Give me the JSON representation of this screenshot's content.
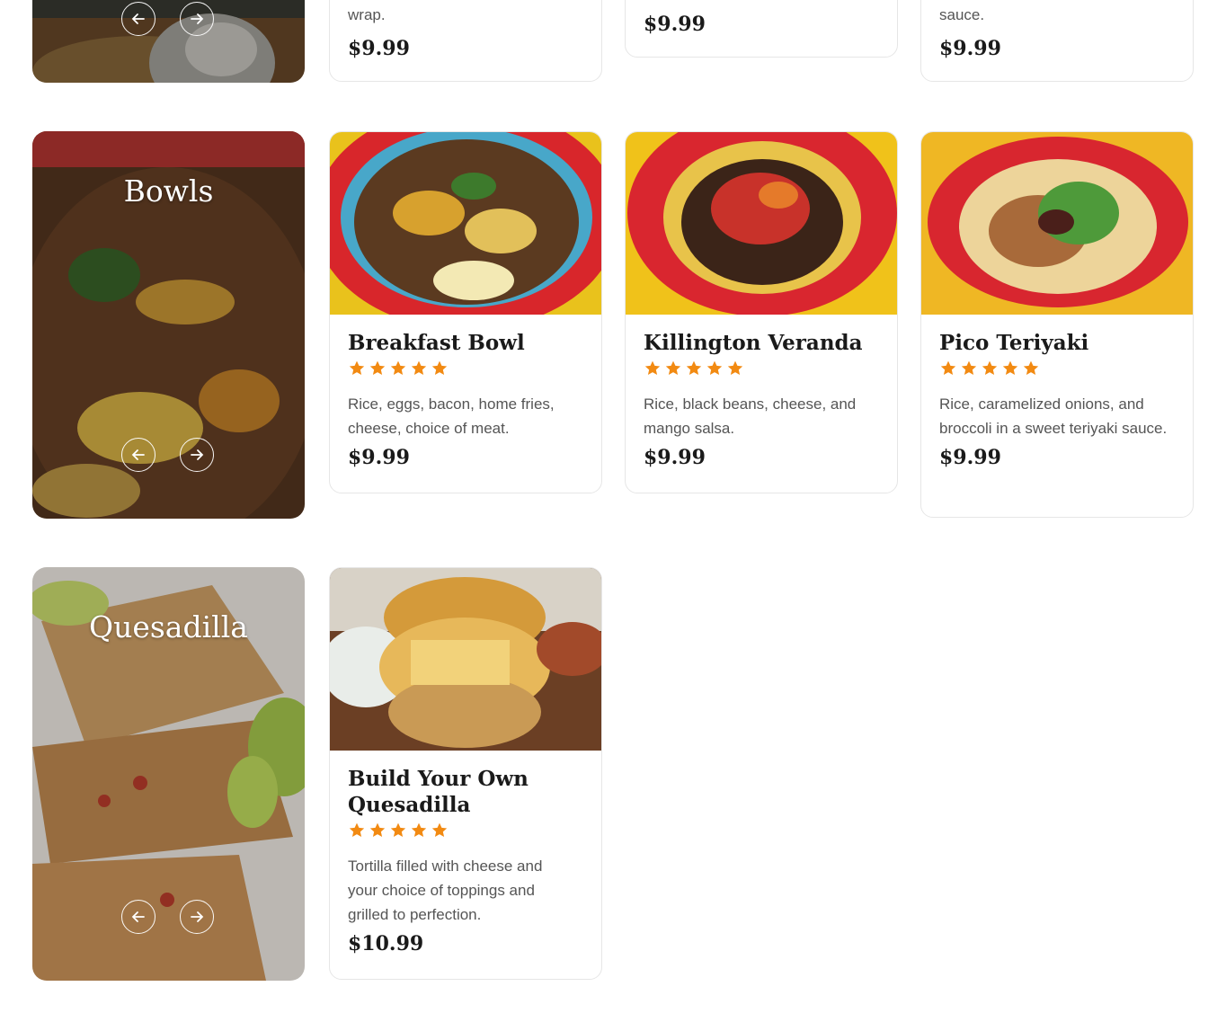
{
  "colors": {
    "star": "#f28a12",
    "card_border": "#e6e6e6",
    "price_text": "#1a1a1a",
    "desc_text": "#555555"
  },
  "top_row": {
    "card1": {
      "desc_tail": "wrap.",
      "price": "$9.99"
    },
    "card2": {
      "price": "$9.99"
    },
    "card3": {
      "desc_tail": "sauce.",
      "price": "$9.99"
    }
  },
  "categories": [
    {
      "title": "Bowls",
      "prev_icon": "arrow-left-icon",
      "next_icon": "arrow-right-icon"
    },
    {
      "title": "Quesadilla",
      "prev_icon": "arrow-left-icon",
      "next_icon": "arrow-right-icon"
    }
  ],
  "bowls": [
    {
      "name": "Breakfast Bowl",
      "rating": 5,
      "desc": "Rice, eggs, bacon, home fries, cheese, choice of meat.",
      "price": "$9.99"
    },
    {
      "name": "Killington Veranda",
      "rating": 5,
      "desc": "Rice, black beans, cheese, and mango salsa.",
      "price": "$9.99"
    },
    {
      "name": "Pico Teriyaki",
      "rating": 5,
      "desc": "Rice, caramelized onions, and broccoli in a sweet teriyaki sauce.",
      "price": "$9.99"
    }
  ],
  "quesadillas": [
    {
      "name": "Build Your Own Quesadilla",
      "rating": 5,
      "desc": "Tortilla filled with cheese and your choice of toppings and grilled to perfection.",
      "price": "$10.99"
    }
  ]
}
